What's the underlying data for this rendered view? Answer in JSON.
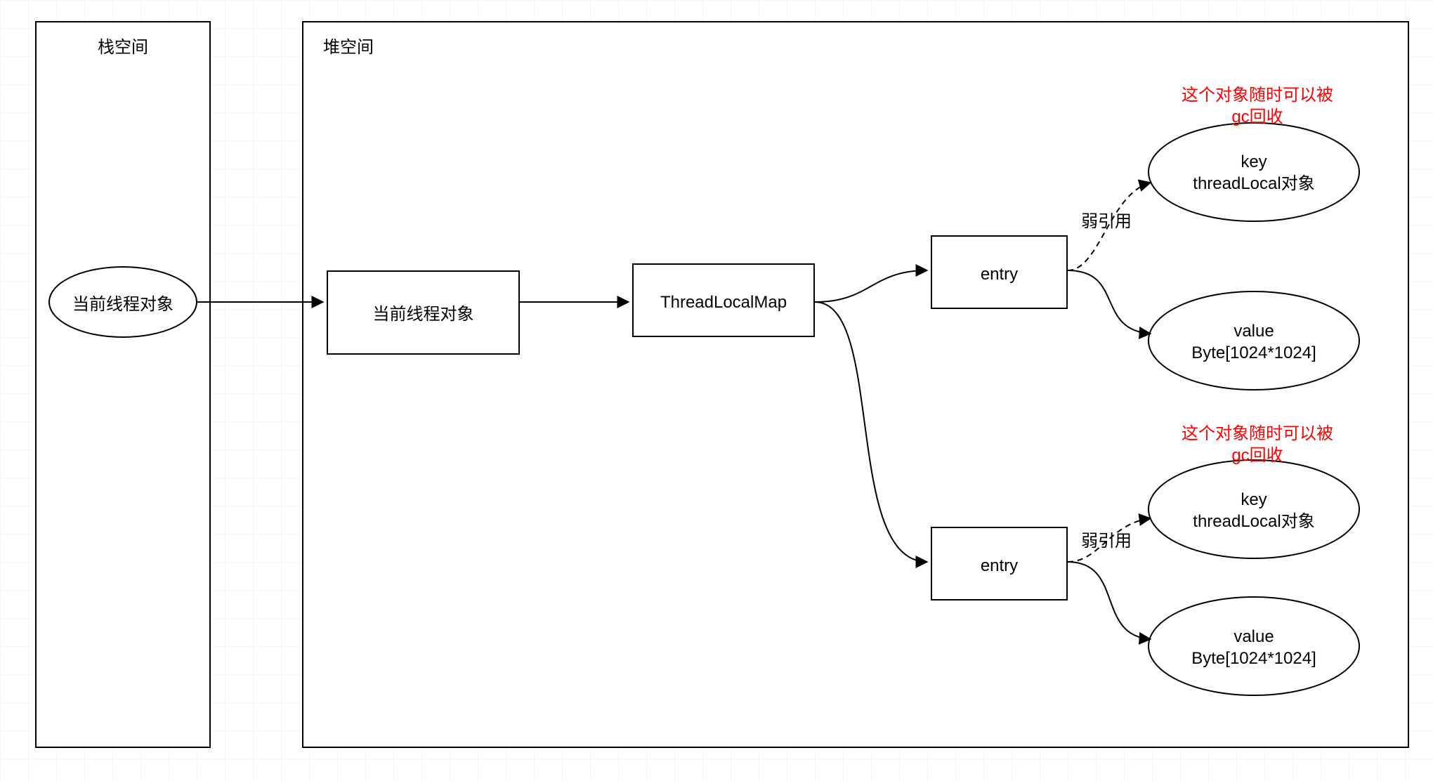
{
  "stack": {
    "title": "栈空间",
    "node": "当前线程对象"
  },
  "heap": {
    "title": "堆空间",
    "thread_obj": "当前线程对象",
    "tlm": "ThreadLocalMap",
    "entry1": "entry",
    "entry2": "entry",
    "weak_ref1": "弱引用",
    "weak_ref2": "弱引用",
    "gc_note1_line1": "这个对象随时可以被",
    "gc_note1_line2": "gc回收",
    "gc_note2_line1": "这个对象随时可以被",
    "gc_note2_line2": "gc回收",
    "key1_line1": "key",
    "key1_line2": "threadLocal对象",
    "key2_line1": "key",
    "key2_line2": "threadLocal对象",
    "val1_line1": "value",
    "val1_line2": "Byte[1024*1024]",
    "val2_line1": "value",
    "val2_line2": "Byte[1024*1024]"
  }
}
